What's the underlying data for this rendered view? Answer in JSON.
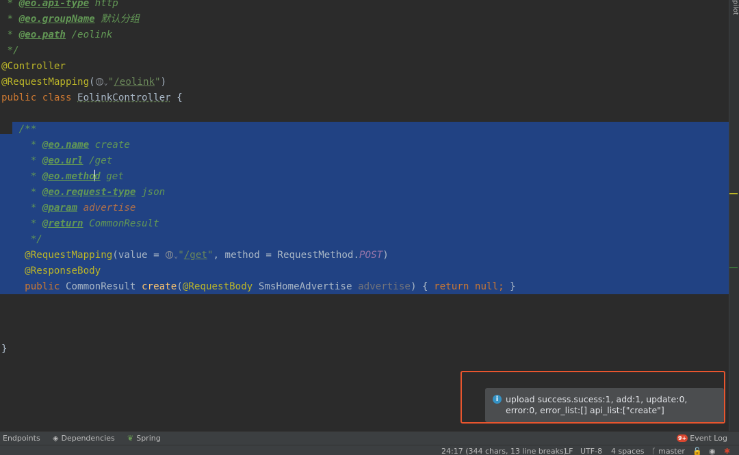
{
  "code": {
    "line0_tag": "@eo.api-type",
    "line0_rest": " http",
    "line1_tag": "@eo.groupName",
    "line1_rest": " 默认分组",
    "line2_tag": "@eo.path",
    "line2_rest": " /eolink",
    "line3": " */",
    "line4": "@Controller",
    "line5_ann": "@RequestMapping",
    "line5_url": "/eolink",
    "line6_kw": "public class ",
    "line6_cls": "EolinkController",
    "line6_rest": " {",
    "doc_open": "/**",
    "doc_name_tag": "@eo.name",
    "doc_name_val": " create",
    "doc_url_tag": "@eo.url",
    "doc_url_val": " /get",
    "doc_method_tag_a": "@eo.metho",
    "doc_method_tag_b": "d",
    "doc_method_val": " get",
    "doc_reqtype_tag": "@eo.request-type",
    "doc_reqtype_val": " json",
    "doc_param_tag": "@param",
    "doc_param_val": " advertise",
    "doc_return_tag": "@return",
    "doc_return_val": " CommonResult",
    "doc_close": "*/",
    "map_ann": "@RequestMapping",
    "map_value": "(value = ",
    "map_url": "/get",
    "map_method": ", method = RequestMethod.",
    "map_const": "POST",
    "map_end": ")",
    "resp_ann": "@ResponseBody",
    "sig_kw": "public",
    "sig_type": " CommonResult ",
    "sig_name": "create",
    "sig_ann": "@RequestBody",
    "sig_ptype": " SmsHomeAdvertise ",
    "sig_pname": "advertise",
    "sig_body_open": ") { ",
    "sig_return": "return null;",
    "sig_body_close": " }",
    "closing_brace": "}"
  },
  "side_label": "pilot",
  "notification": {
    "icon": "info-icon",
    "text": "upload success.sucess:1, add:1, update:0, error:0, error_list:[] api_list:[\"create\"]"
  },
  "toolbar": {
    "endpoints": "Endpoints",
    "dependencies": "Dependencies",
    "spring": "Spring",
    "event_log_badge": "9+",
    "event_log": "Event Log"
  },
  "statusbar": {
    "position": "24:17 (344 chars, 13 line breaks)",
    "line_sep": "LF",
    "encoding": "UTF-8",
    "indent": "4 spaces",
    "branch": "master"
  },
  "colors": {
    "editor_bg": "#2b2b2b",
    "selection": "#214283",
    "annotation": "#bbb529",
    "keyword": "#cc7832",
    "comment": "#629755",
    "highlight_border": "#e8552e"
  }
}
